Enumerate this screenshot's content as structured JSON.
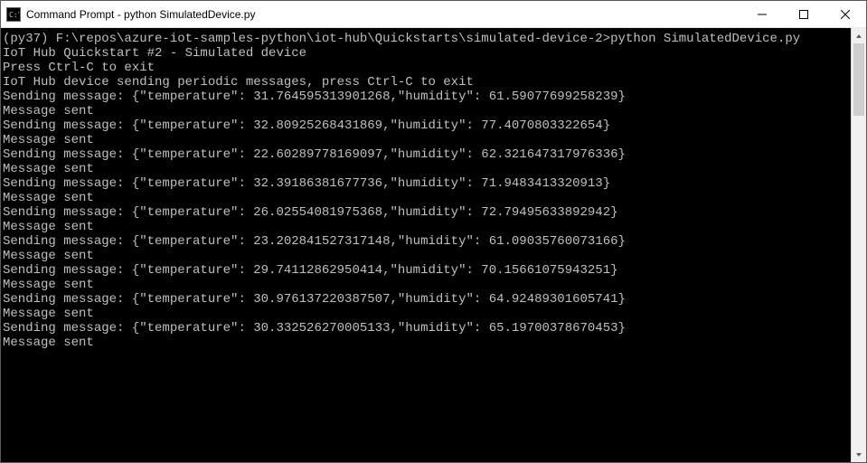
{
  "window": {
    "title": "Command Prompt - python  SimulatedDevice.py"
  },
  "prompt": {
    "prefix": "(py37) F:\\repos\\azure-iot-samples-python\\iot-hub\\Quickstarts\\simulated-device-2>",
    "command": "python SimulatedDevice.py"
  },
  "header_lines": [
    "IoT Hub Quickstart #2 - Simulated device",
    "Press Ctrl-C to exit",
    "IoT Hub device sending periodic messages, press Ctrl-C to exit"
  ],
  "message_sent_label": "Message sent",
  "sending_prefix": "Sending message: ",
  "messages": [
    {
      "temperature": "31.764595313901268",
      "humidity": "61.59077699258239"
    },
    {
      "temperature": "32.80925268431869",
      "humidity": "77.4070803322654"
    },
    {
      "temperature": "22.60289778169097",
      "humidity": "62.321647317976336"
    },
    {
      "temperature": "32.39186381677736",
      "humidity": "71.9483413320913"
    },
    {
      "temperature": "26.02554081975368",
      "humidity": "72.79495633892942"
    },
    {
      "temperature": "23.202841527317148",
      "humidity": "61.09035760073166"
    },
    {
      "temperature": "29.74112862950414",
      "humidity": "70.15661075943251"
    },
    {
      "temperature": "30.976137220387507",
      "humidity": "64.92489301605741"
    },
    {
      "temperature": "30.332526270005133",
      "humidity": "65.19700378670453"
    }
  ]
}
